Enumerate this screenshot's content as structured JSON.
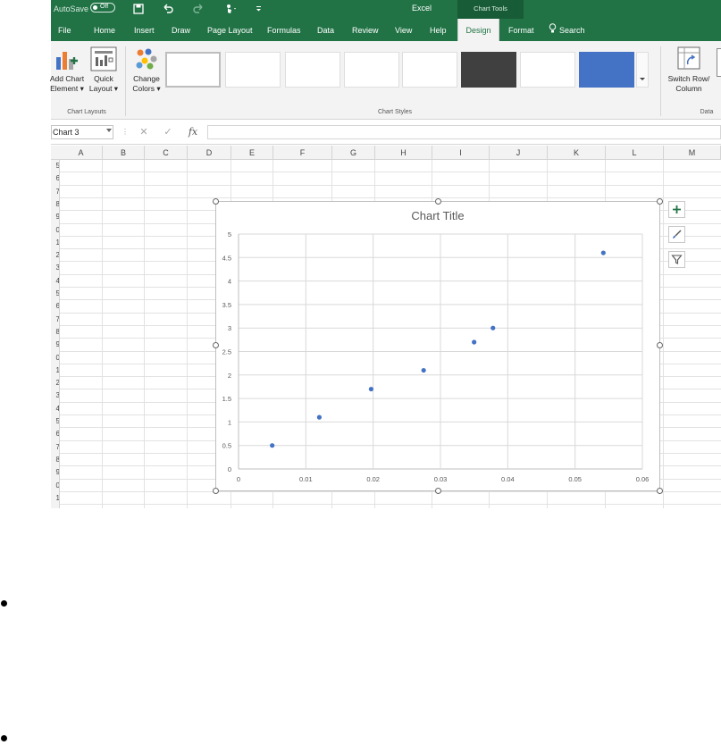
{
  "titlebar": {
    "autosave_label": "AutoSave",
    "autosave_state": "Off",
    "app_name": "Excel",
    "context_group": "Chart Tools"
  },
  "tabs": [
    {
      "label": "File"
    },
    {
      "label": "Home"
    },
    {
      "label": "Insert"
    },
    {
      "label": "Draw"
    },
    {
      "label": "Page Layout"
    },
    {
      "label": "Formulas"
    },
    {
      "label": "Data"
    },
    {
      "label": "Review"
    },
    {
      "label": "View"
    },
    {
      "label": "Help"
    },
    {
      "label": "Design",
      "active": true
    },
    {
      "label": "Format"
    },
    {
      "label": "Search"
    }
  ],
  "ribbon": {
    "add_chart_element": [
      "Add Chart",
      "Element ▾"
    ],
    "quick_layout": [
      "Quick",
      "Layout ▾"
    ],
    "change_colors": [
      "Change",
      "Colors ▾"
    ],
    "switch_row_column": [
      "Switch Row/",
      "Column"
    ],
    "groups": {
      "chart_layouts": "Chart Layouts",
      "chart_styles": "Chart Styles",
      "data": "Data"
    }
  },
  "formula_bar": {
    "name_box": "Chart 3",
    "cancel_symbol": "✕",
    "enter_symbol": "✓",
    "fx_symbol": "fx",
    "formula": ""
  },
  "columns": [
    "A",
    "B",
    "C",
    "D",
    "E",
    "F",
    "G",
    "H",
    "I",
    "J",
    "K",
    "L",
    "M"
  ],
  "rows": [
    "5",
    "6",
    "7",
    "8",
    "9",
    "0",
    "1",
    "2",
    "3",
    "4",
    "5",
    "6",
    "7",
    "8",
    "9",
    "0",
    "1",
    "2",
    "3",
    "4",
    "5",
    "6",
    "7",
    "8",
    "9",
    "0",
    "1"
  ],
  "chart_data": {
    "type": "scatter",
    "title": "Chart Title",
    "x": [
      0.005,
      0.012,
      0.0197,
      0.0275,
      0.035,
      0.0378,
      0.0542
    ],
    "y": [
      0.5,
      1.1,
      1.7,
      2.1,
      2.7,
      3.0,
      4.6
    ],
    "xlim": [
      0,
      0.06
    ],
    "ylim": [
      0,
      5
    ],
    "x_ticks": [
      "0",
      "0.01",
      "0.02",
      "0.03",
      "0.04",
      "0.05",
      "0.06"
    ],
    "y_ticks": [
      "0",
      "0.5",
      "1",
      "1.5",
      "2",
      "2.5",
      "3",
      "3.5",
      "4",
      "4.5",
      "5"
    ],
    "grid": true,
    "legend": "none",
    "marker_color": "#4472c4"
  },
  "colors": {
    "excel_green": "#217346",
    "ribbon_bg": "#f3f3f3",
    "marker": "#4472c4"
  },
  "icons": {
    "chart_elements": "plus-icon",
    "chart_styles": "brush-icon",
    "chart_filters": "filter-icon"
  }
}
